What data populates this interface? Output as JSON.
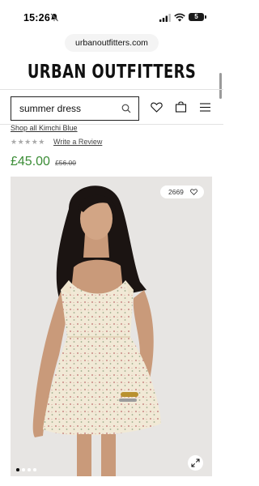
{
  "status_bar": {
    "time": "15:26",
    "battery": "5"
  },
  "browser": {
    "url": "urbanoutfitters.com"
  },
  "header": {
    "brand": "URBAN OUTFITTERS"
  },
  "search": {
    "value": "summer dress"
  },
  "product": {
    "shop_all_link": "Shop all Kimchi Blue",
    "stars": "★★★★★",
    "write_review": "Write a Review",
    "price_current": "£45.00",
    "price_original": "£56.00",
    "likes": "2669",
    "carousel": {
      "total_images": 4,
      "active_index": 0
    }
  },
  "colors": {
    "sale_price": "#3a8c35",
    "image_background": "#e7e5e3"
  },
  "icons": [
    "silent-bell-icon",
    "signal-icon",
    "wifi-icon",
    "search-icon",
    "heart-icon",
    "bag-icon",
    "menu-icon",
    "expand-icon"
  ]
}
